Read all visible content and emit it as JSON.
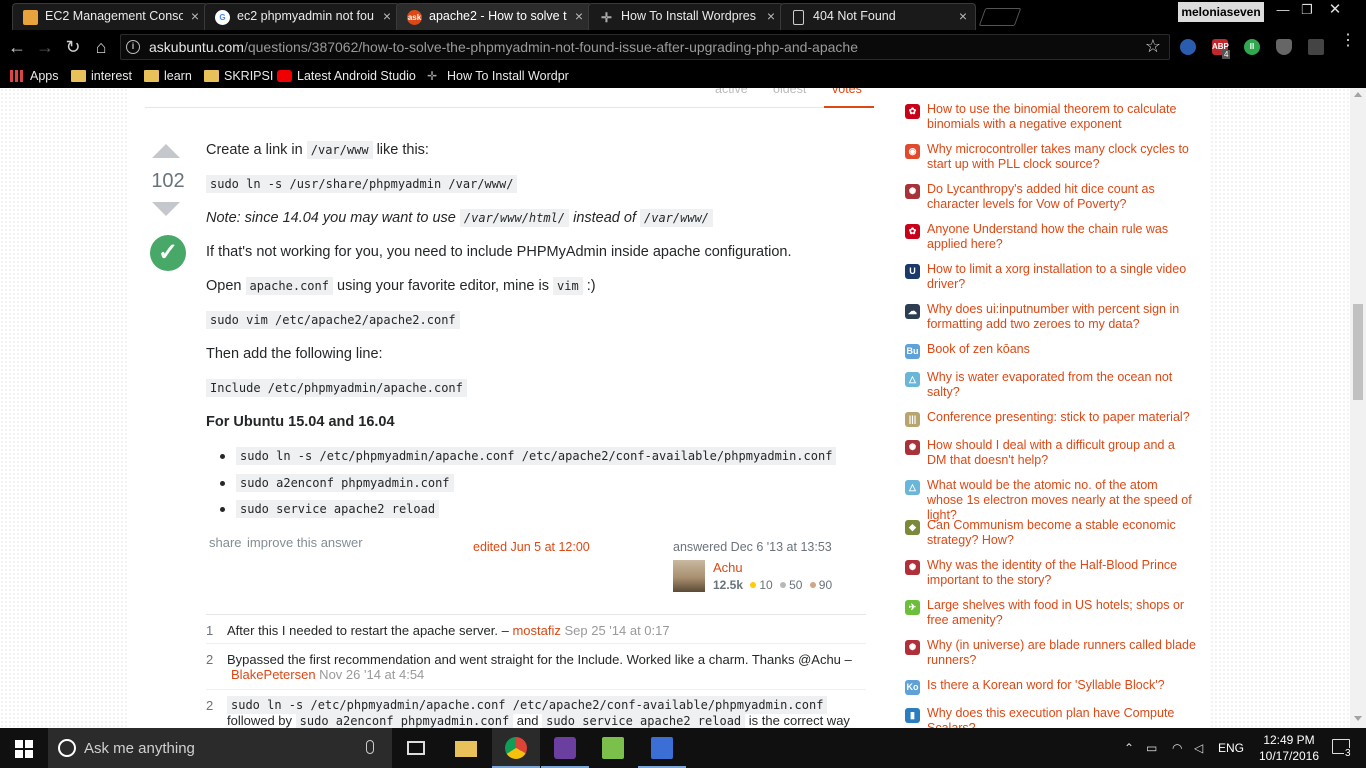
{
  "browser": {
    "tabs": [
      {
        "title": "EC2 Management Conso",
        "favicon": "aws-icon",
        "color": "#e8a33d"
      },
      {
        "title": "ec2 phpmyadmin not fou",
        "favicon": "google-icon",
        "color": "#ffffff"
      },
      {
        "title": "apache2 - How to solve t",
        "favicon": "askubuntu-icon",
        "color": "#dd4814"
      },
      {
        "title": "How To Install Wordpres",
        "favicon": "digitalocean-icon",
        "color": "#888888"
      },
      {
        "title": "404 Not Found",
        "favicon": "page-icon",
        "color": "#cccccc"
      }
    ],
    "profile": "meloniaseven",
    "url_host": "askubuntu.com",
    "url_path": "/questions/387062/how-to-solve-the-phpmyadmin-not-found-issue-after-upgrading-php-and-apache",
    "abp_count": "4",
    "bookmarks": [
      {
        "label": "Apps",
        "icon": "apps-icon"
      },
      {
        "label": "interest",
        "icon": "folder-icon"
      },
      {
        "label": "learn",
        "icon": "folder-icon"
      },
      {
        "label": "SKRIPSI",
        "icon": "folder-icon"
      },
      {
        "label": "Latest Android Studio",
        "icon": "youtube-icon"
      },
      {
        "label": "How To Install Wordpr",
        "icon": "digitalocean-icon"
      }
    ]
  },
  "sort_tabs": [
    "active",
    "oldest",
    "votes"
  ],
  "answer": {
    "votes": "102",
    "p1": {
      "a": "Create a link in ",
      "code": "/var/www",
      "b": " like this:"
    },
    "code1": "sudo ln -s /usr/share/phpmyadmin /var/www/",
    "note": {
      "a": "Note: since 14.04 you may want to use ",
      "code1": "/var/www/html/",
      "b": " instead of ",
      "code2": "/var/www/"
    },
    "p2": "If that's not working for you, you need to include PHPMyAdmin inside apache configuration.",
    "p3": {
      "a": "Open ",
      "code1": "apache.conf",
      "b": " using your favorite editor, mine is ",
      "code2": "vim",
      "c": " :)"
    },
    "code2": "sudo vim /etc/apache2/apache2.conf",
    "p4": "Then add the following line:",
    "code3": "Include /etc/phpmyadmin/apache.conf",
    "h3": "For Ubuntu 15.04 and 16.04",
    "bullets": [
      "sudo ln -s /etc/phpmyadmin/apache.conf /etc/apache2/conf-available/phpmyadmin.conf",
      "sudo a2enconf phpmyadmin.conf",
      "sudo service apache2 reload"
    ],
    "share": "share",
    "improve": "improve this answer",
    "edited": "edited Jun 5 at 12:00",
    "answered": "answered Dec 6 '13 at 13:53",
    "user": {
      "name": "Achu",
      "rep": "12.5k",
      "gold": "10",
      "silver": "50",
      "bronze": "90"
    }
  },
  "comments": [
    {
      "score": "1",
      "text": "After this I needed to restart the apache server. – ",
      "user": "mostafiz",
      "date": " Sep 25 '14 at 0:17"
    },
    {
      "score": "2",
      "text": "Bypassed the first recommendation and went straight for the Include. Worked like a charm. Thanks @Achu –",
      "user": "BlakePetersen",
      "date": " Nov 26 '14 at 4:54"
    },
    {
      "score": "2",
      "code1": "sudo ln -s /etc/phpmyadmin/apache.conf /etc/apache2/conf-available/phpmyadmin.conf",
      "t1": "followed by ",
      "code2": "sudo a2enconf phpmyadmin.conf",
      "t2": " and ",
      "code3": "sudo service apache2 reload",
      "t3": " is the correct way"
    }
  ],
  "hot_questions": [
    {
      "text": "How to use the binomial theorem to calculate binomials with a negative exponent",
      "icon": "math-icon",
      "color": "#c9001a"
    },
    {
      "text": "Why microcontroller takes many clock cycles to start up with PLL clock source?",
      "icon": "electronics-icon",
      "color": "#e14a2c"
    },
    {
      "text": "Do Lycanthropy's added hit dice count as character levels for Vow of Poverty?",
      "icon": "rpg-icon",
      "color": "#a8323a"
    },
    {
      "text": "Anyone Understand how the chain rule was applied here?",
      "icon": "math-icon",
      "color": "#c9001a"
    },
    {
      "text": "How to limit a xorg installation to a single video driver?",
      "icon": "unix-icon",
      "color": "#1a3a6a"
    },
    {
      "text": "Why does ui:inputnumber with percent sign in formatting add two zeroes to my data?",
      "icon": "stackoverflow-icon",
      "color": "#2e3e52"
    },
    {
      "text": "Book of zen kōans",
      "icon": "buddhism-icon",
      "color": "#5ea2d8"
    },
    {
      "text": "Why is water evaporated from the ocean not salty?",
      "icon": "chemistry-icon",
      "color": "#6ab6d8"
    },
    {
      "text": "Conference presenting: stick to paper material?",
      "icon": "academia-icon",
      "color": "#b8a46e"
    },
    {
      "text": "How should I deal with a difficult group and a DM that doesn't help?",
      "icon": "rpg-icon",
      "color": "#a8323a"
    },
    {
      "text": "What would be the atomic no. of the atom whose 1s electron moves nearly at the speed of light?",
      "icon": "chemistry-icon",
      "color": "#6ab6d8"
    },
    {
      "text": "Can Communism become a stable economic strategy? How?",
      "icon": "politics-icon",
      "color": "#7a8a3a"
    },
    {
      "text": "Why was the identity of the Half-Blood Prince important to the story?",
      "icon": "scifi-icon",
      "color": "#b0303a"
    },
    {
      "text": "Large shelves with food in US hotels; shops or free amenity?",
      "icon": "travel-icon",
      "color": "#6bbf3a"
    },
    {
      "text": "Why (in universe) are blade runners called blade runners?",
      "icon": "scifi-icon",
      "color": "#b0303a"
    },
    {
      "text": "Is there a Korean word for 'Syllable Block'?",
      "icon": "korean-icon",
      "color": "#5ea2d8"
    },
    {
      "text": "Why does this execution plan have Compute Scalars?",
      "icon": "dba-icon",
      "color": "#2a7ec0"
    }
  ],
  "taskbar": {
    "search_placeholder": "Ask me anything",
    "lang": "ENG",
    "time": "12:49 PM",
    "date": "10/17/2016",
    "notifications": "3",
    "apps": [
      "file-explorer-icon",
      "chrome-icon",
      "game-icon",
      "notepad-icon",
      "network-tool-icon"
    ]
  }
}
